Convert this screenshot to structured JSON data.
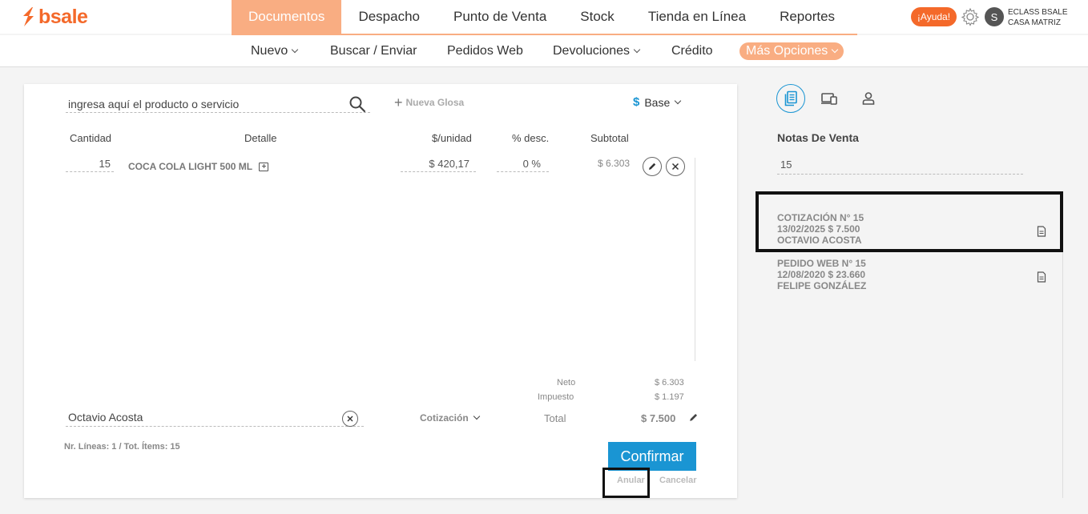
{
  "brand": {
    "name": "bsale",
    "color": "#f4692a",
    "accent": "#f9ad82",
    "primary": "#1a95d3"
  },
  "mainnav": [
    "Documentos",
    "Despacho",
    "Punto de Venta",
    "Stock",
    "Tienda en Línea",
    "Reportes"
  ],
  "help_label": "¡Ayuda!",
  "user": {
    "initial": "S",
    "line1": "ECLASS BSALE",
    "line2": "CASA MATRIZ"
  },
  "subnav": {
    "nuevo": "Nuevo",
    "buscar": "Buscar / Enviar",
    "pedidos": "Pedidos Web",
    "devoluciones": "Devoluciones",
    "credito": "Crédito",
    "mas": "Más Opciones"
  },
  "editor": {
    "search_placeholder": "ingresa aquí el producto o servicio",
    "nueva_glosa": "Nueva Glosa",
    "price_list_symbol": "$",
    "price_list": "Base",
    "columns": {
      "cantidad": "Cantidad",
      "detalle": "Detalle",
      "unidad": "$/unidad",
      "desc": "% desc.",
      "subtotal": "Subtotal"
    },
    "line": {
      "cantidad": "15",
      "detalle": "COCA COLA LIGHT 500 ML",
      "unidad": "$ 420,17",
      "desc": "0 %",
      "subtotal": "$ 6.303"
    },
    "totals": {
      "neto_label": "Neto",
      "neto": "$ 6.303",
      "impuesto_label": "Impuesto",
      "impuesto": "$ 1.197",
      "total_label": "Total",
      "total": "$ 7.500"
    },
    "client": "Octavio Acosta",
    "doc_type": "Cotización",
    "summary": "Nr. Líneas: 1 / Tot. Ítems: 15",
    "confirm": "Confirmar",
    "anular": "Anular",
    "cancelar": "Cancelar"
  },
  "panel": {
    "title": "Notas De Venta",
    "search_value": "15",
    "docs": [
      {
        "line1": "COTIZACIÓN N° 15",
        "line2": "13/02/2025 $ 7.500",
        "line3": "OCTAVIO ACOSTA"
      },
      {
        "line1": "PEDIDO WEB N° 15",
        "line2": "12/08/2020 $ 23.660",
        "line3": "FELIPE GONZÁLEZ"
      }
    ]
  }
}
